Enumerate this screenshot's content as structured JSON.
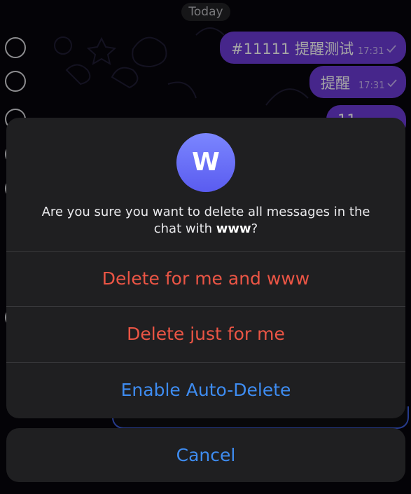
{
  "chat": {
    "date_label": "Today",
    "messages": [
      {
        "text": "#11111 提醒测试",
        "time": "17:31"
      },
      {
        "text": "提醒",
        "time": "17:31"
      },
      {
        "text": "11",
        "time": ""
      }
    ]
  },
  "dialog": {
    "avatar_letter": "W",
    "prompt_before": "Are you sure you want to delete all messages in the chat with ",
    "prompt_name": "www",
    "prompt_after": "?",
    "actions": [
      {
        "label": "Delete for me and www",
        "style": "destructive"
      },
      {
        "label": "Delete just for me",
        "style": "destructive"
      },
      {
        "label": "Enable Auto-Delete",
        "style": "default"
      }
    ],
    "cancel_label": "Cancel"
  },
  "colors": {
    "accent_blue": "#3e8cf1",
    "destructive_red": "#eb5545",
    "bubble_purple": "#6c3bd6",
    "sheet_background": "#1f1f21"
  }
}
